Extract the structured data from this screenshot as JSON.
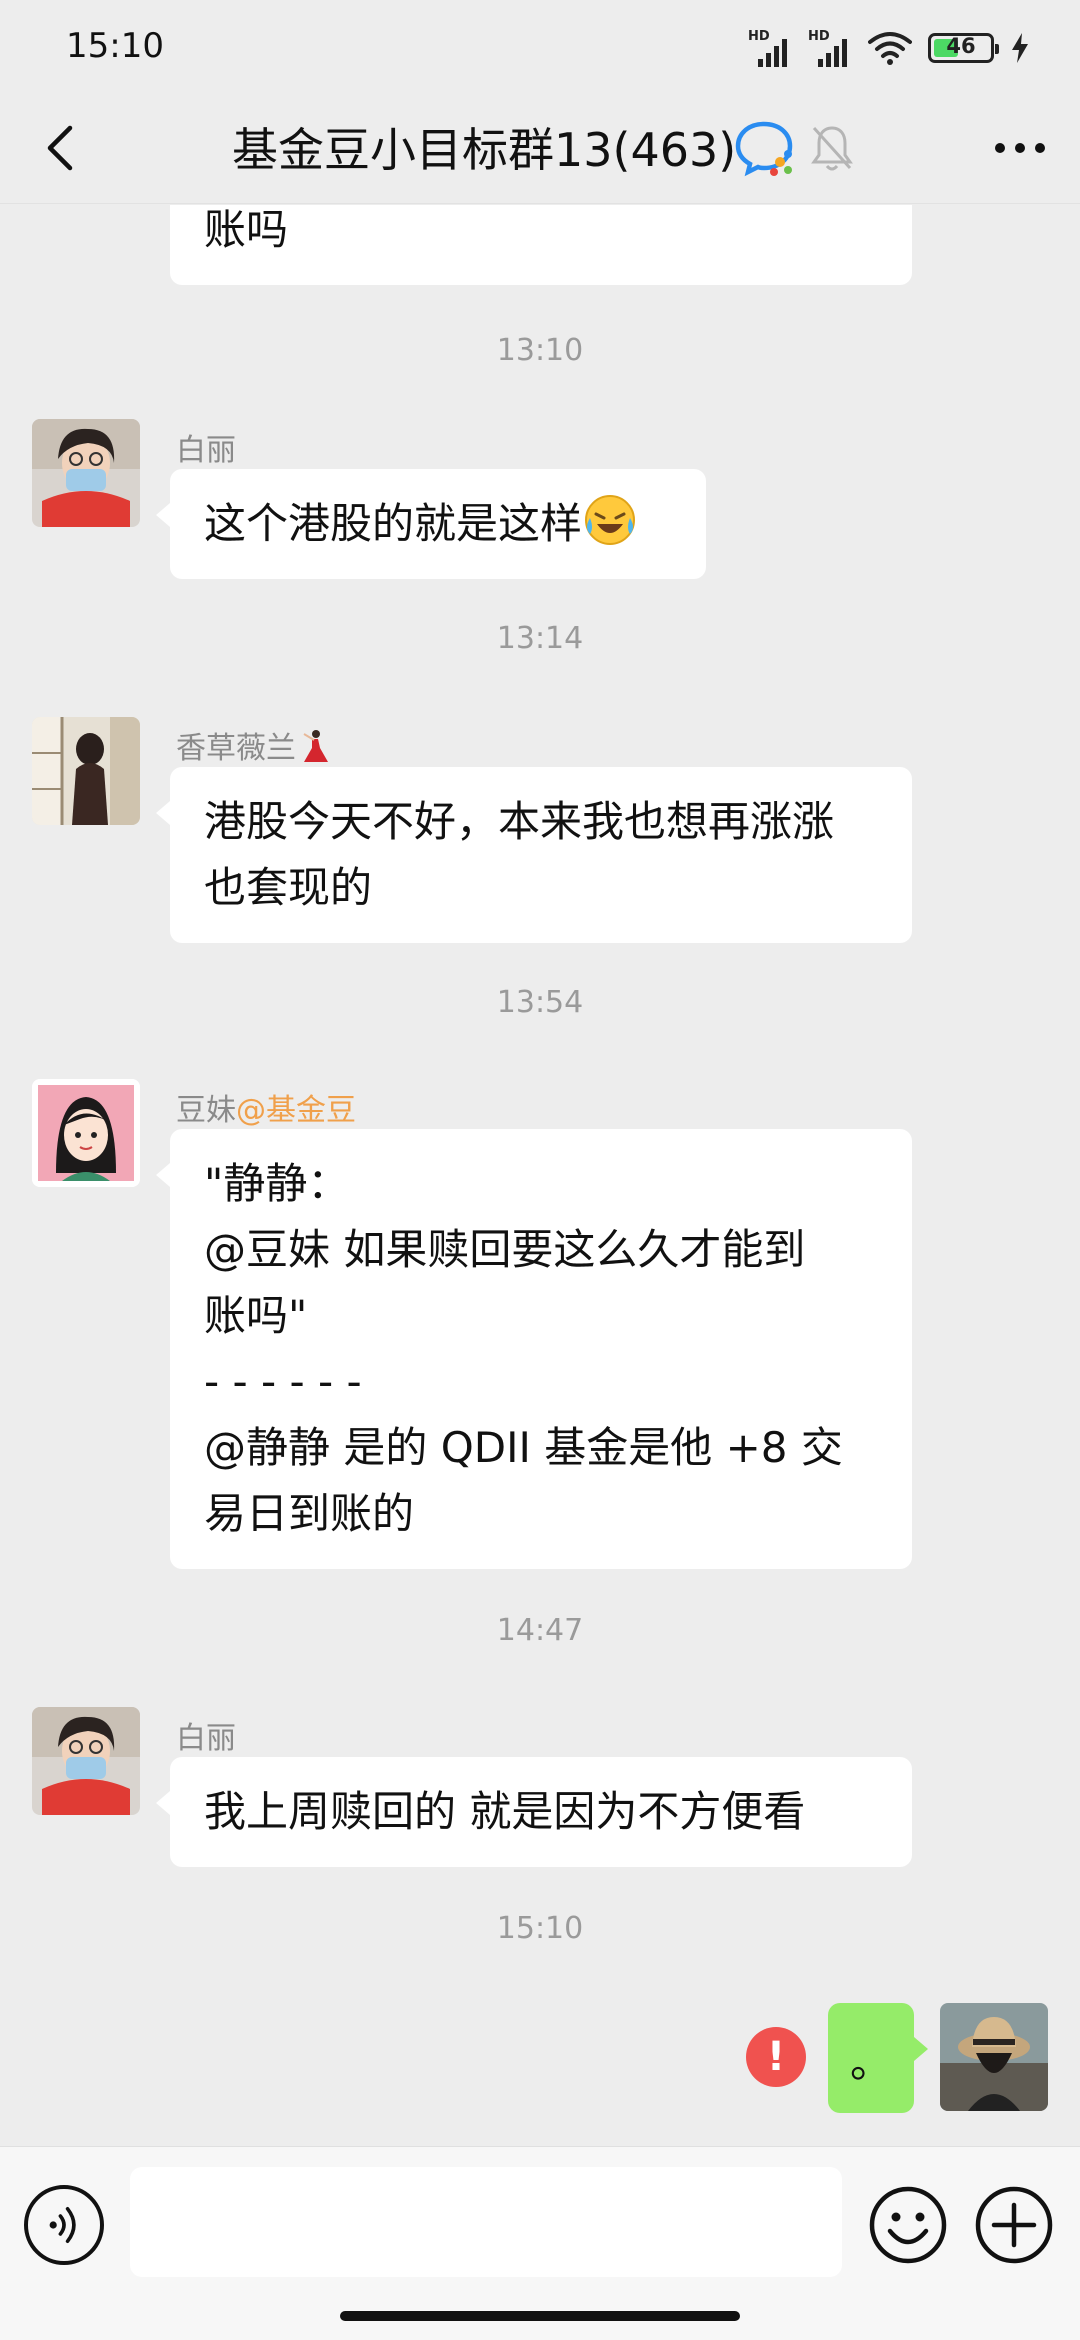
{
  "status_bar": {
    "time": "15:10",
    "signal1_label": "HD",
    "signal2_label": "HD",
    "battery_level": "46"
  },
  "nav": {
    "title": "基金豆小目标群13(463)"
  },
  "messages": {
    "prev_tail": "账吗",
    "ts1": "13:10",
    "m1_sender": "白丽",
    "m1_text": "这个港股的就是这样",
    "ts2": "13:14",
    "m2_sender": "香草薇兰",
    "m2_line1": "港股今天不好，本来我也想再涨涨",
    "m2_line2": "也套现的",
    "ts3": "13:54",
    "m3_sender": "豆妹",
    "m3_sender_tag": "@基金豆",
    "m3_line1": "\"静静：",
    "m3_line2": "@豆妹  如果赎回要这么久才能到",
    "m3_line3": "账吗\"",
    "m3_line4": "- - - - - -",
    "m3_line5": "@静静 是的 QDII 基金是他 +8 交",
    "m3_line6": "易日到账的",
    "ts4": "14:47",
    "m4_sender": "白丽",
    "m4_text": "我上周赎回的 就是因为不方便看",
    "ts5": "15:10",
    "my_text": "。",
    "error_mark": "!"
  },
  "input": {
    "placeholder": ""
  },
  "colors": {
    "background": "#ededed",
    "bubble_in": "#ffffff",
    "bubble_out": "#95ec69",
    "error": "#f0524f",
    "sender_tag": "#f0a04b"
  }
}
